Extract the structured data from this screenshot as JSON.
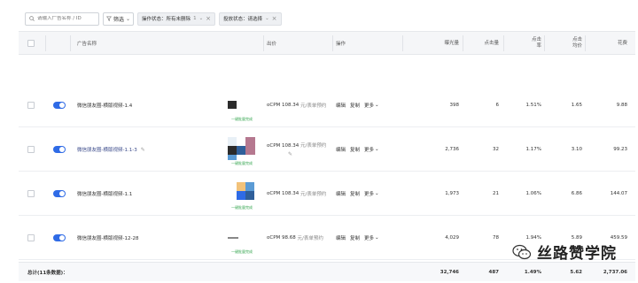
{
  "filters": {
    "search_placeholder": "请输入广告名称 / ID",
    "filter_label": "筛选",
    "tags": [
      {
        "label": "操作状态：所有未删除",
        "count": "1"
      },
      {
        "label": "投放状态：请选择"
      }
    ]
  },
  "table": {
    "headers": {
      "name": "广告名称",
      "bid": "出价",
      "ops": "操作",
      "impressions": "曝光量",
      "clicks": "点击量",
      "ctr": [
        "点击",
        "率"
      ],
      "cpc": [
        "点击",
        "均价"
      ],
      "spend": "花费"
    },
    "rows": [
      {
        "name": "微信朋友圈-横版视频-1.4",
        "bid": "oCPM  108.34",
        "bid_unit": "元/表单预约",
        "ops": [
          "编辑",
          "复制",
          "更多"
        ],
        "impressions": "398",
        "clicks": "6",
        "ctr": "1.51%",
        "cpc": "1.65",
        "spend": "9.88",
        "thumb_button": "一键批量完成"
      },
      {
        "name": "微信朋友圈-横版视频-1.1-3",
        "bid": "oCPM  108.34",
        "bid_unit": "元/表单预约",
        "ops": [
          "编辑",
          "复制",
          "更多"
        ],
        "impressions": "2,736",
        "clicks": "32",
        "ctr": "1.17%",
        "cpc": "3.10",
        "spend": "99.23",
        "thumb_button": "一键批量完成"
      },
      {
        "name": "微信朋友圈-横版视频-1.1",
        "bid": "oCPM  108.34",
        "bid_unit": "元/表单预约",
        "ops": [
          "编辑",
          "复制",
          "更多"
        ],
        "impressions": "1,973",
        "clicks": "21",
        "ctr": "1.06%",
        "cpc": "6.86",
        "spend": "144.07",
        "thumb_button": "一键批量完成"
      },
      {
        "name": "微信朋友圈-横版视频-12-28",
        "bid": "oCPM  98.68",
        "bid_unit": "元/表单预约",
        "ops": [
          "编辑",
          "复制",
          "更多"
        ],
        "impressions": "4,029",
        "clicks": "78",
        "ctr": "1.94%",
        "cpc": "5.89",
        "spend": "459.59",
        "thumb_button": "一键批量完成"
      }
    ],
    "total": {
      "label": "总计(11条数据)：",
      "impressions": "32,746",
      "clicks": "487",
      "ctr": "1.49%",
      "cpc": "5.62",
      "spend": "2,737.06"
    }
  },
  "watermark": {
    "text": "丝路赞学院"
  },
  "colors": {
    "accent": "#2f6be6",
    "thumb_button": "#2fa34a"
  }
}
